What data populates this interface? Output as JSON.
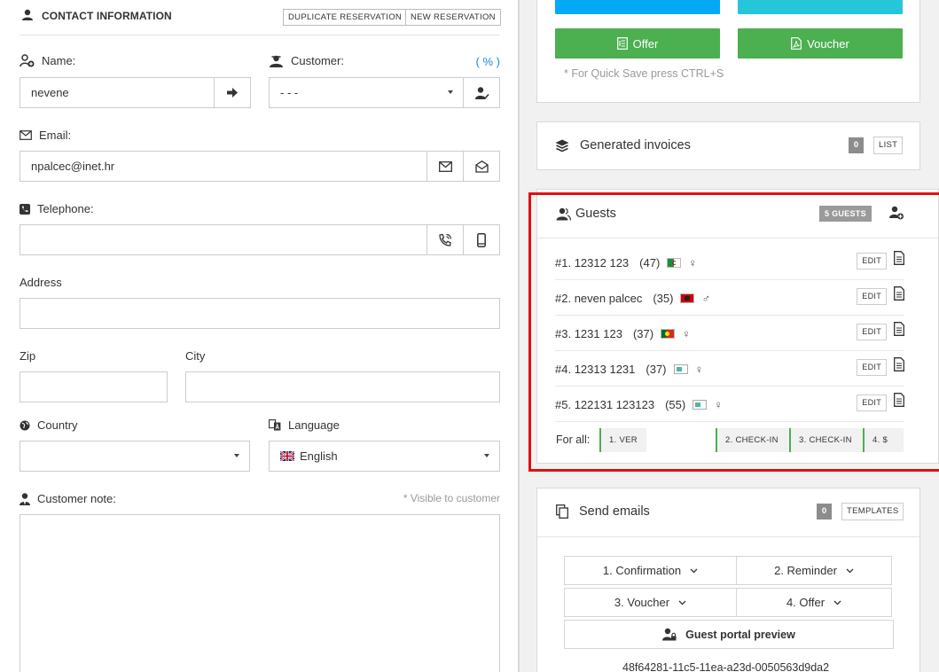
{
  "contact": {
    "section_title": "CONTACT INFORMATION",
    "duplicate_label": "DUPLICATE RESERVATION",
    "new_label": "NEW RESERVATION",
    "name_label": "Name:",
    "name_value": "nevene",
    "customer_label": "Customer:",
    "percent_label": "( % )",
    "customer_value": "- - -",
    "email_label": "Email:",
    "email_value": "npalcec@inet.hr",
    "telephone_label": "Telephone:",
    "telephone_value": "",
    "address_label": "Address",
    "address_value": "",
    "zip_label": "Zip",
    "zip_value": "",
    "city_label": "City",
    "city_value": "",
    "country_label": "Country",
    "country_value": "",
    "language_label": "Language",
    "language_value": "English",
    "note_label": "Customer note:",
    "note_hint": "* Visible to customer",
    "note_value": ""
  },
  "actions": {
    "offer_label": "Offer",
    "voucher_label": "Voucher",
    "quick_save": "* For Quick Save press CTRL+S",
    "top_left_color": "#03a9f4",
    "top_right_color": "#26c6da",
    "green": "#4caf50"
  },
  "invoices": {
    "title": "Generated invoices",
    "count": "0",
    "list_label": "LIST"
  },
  "guests": {
    "title": "Guests",
    "badge": "5 GUESTS",
    "edit_label": "EDIT",
    "rows": [
      {
        "num": "#1.",
        "name": "12312 123",
        "age": "(47)",
        "flag": "flag-algeria",
        "gender": "♀"
      },
      {
        "num": "#2.",
        "name": "neven palcec",
        "age": "(35)",
        "flag": "flag-albania",
        "gender": "♂"
      },
      {
        "num": "#3.",
        "name": "1231 123",
        "age": "(37)",
        "flag": "flag-portugal",
        "gender": "♀"
      },
      {
        "num": "#4.",
        "name": "12313 1231",
        "age": "(37)",
        "flag": "broken-image",
        "gender": "♀"
      },
      {
        "num": "#5.",
        "name": "122131 123123",
        "age": "(55)",
        "flag": "broken-image",
        "gender": "♀"
      }
    ],
    "for_all_label": "For all:",
    "for_all_buttons": [
      "1. VER",
      "2. CHECK-IN",
      "3. CHECK-IN",
      "4.  $"
    ]
  },
  "emails": {
    "title": "Send emails",
    "count": "0",
    "templates_label": "TEMPLATES",
    "confirmation": "1. Confirmation",
    "reminder": "2. Reminder",
    "voucher": "3. Voucher",
    "offer": "4. Offer",
    "portal_preview": "Guest portal preview",
    "guid": "48f64281-11c5-11ea-a23d-0050563d9da2"
  }
}
